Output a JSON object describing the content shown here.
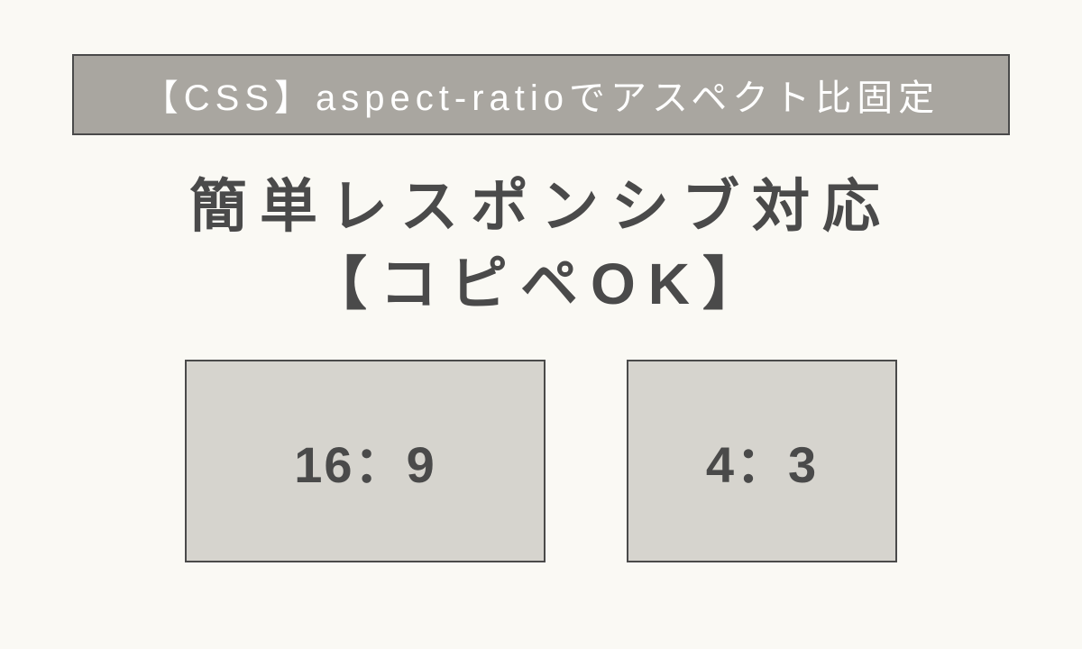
{
  "banner": {
    "text": "【CSS】aspect-ratioでアスペクト比固定"
  },
  "headline": {
    "line1": "簡単レスポンシブ対応",
    "line2": "【コピペOK】"
  },
  "ratios": {
    "box1": {
      "label": "16：9"
    },
    "box2": {
      "label": "4：3"
    }
  }
}
